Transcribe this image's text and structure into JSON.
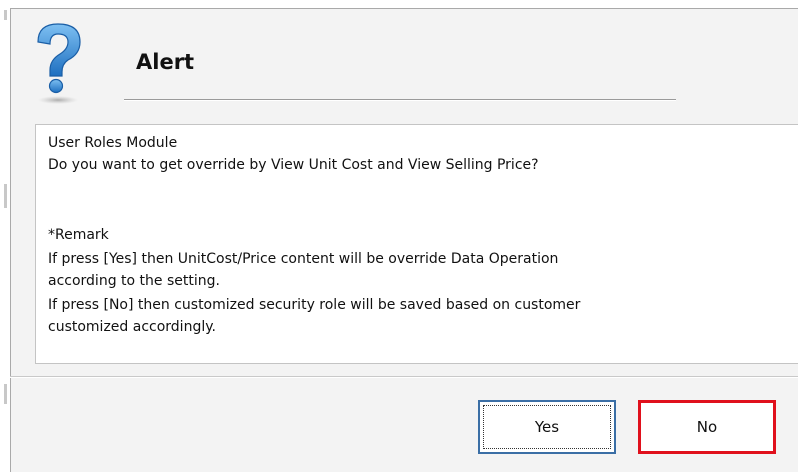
{
  "dialog": {
    "title": "Alert",
    "icon": "question-mark-icon",
    "accent_color": "#3f8fd6"
  },
  "message": {
    "module": "User Roles Module",
    "question": "Do you want to get override by View Unit Cost and View Selling Price?",
    "remark_heading": "*Remark",
    "remark_lines": [
      "If press [Yes] then UnitCost/Price content will be override Data Operation",
      "according to the setting.",
      "If press [No] then customized security role will be saved based on customer",
      "customized accordingly."
    ]
  },
  "buttons": {
    "yes_label": "Yes",
    "no_label": "No",
    "no_highlight_color": "#e0101c"
  }
}
